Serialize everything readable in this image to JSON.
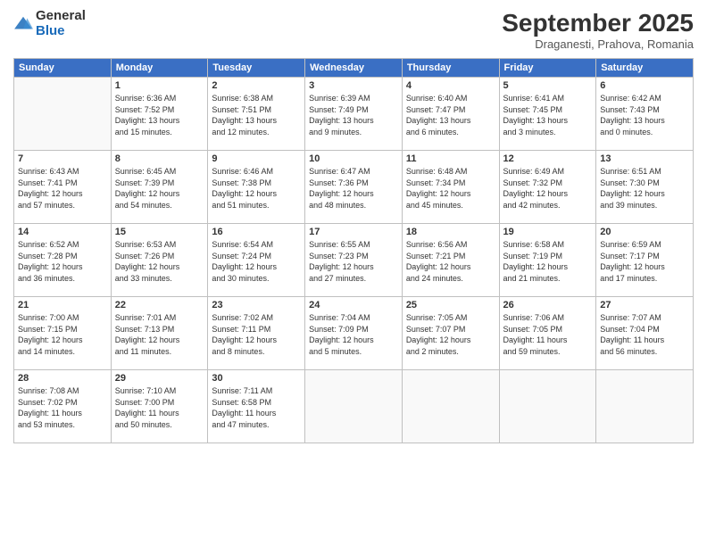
{
  "logo": {
    "general": "General",
    "blue": "Blue"
  },
  "title": "September 2025",
  "location": "Draganesti, Prahova, Romania",
  "weekdays": [
    "Sunday",
    "Monday",
    "Tuesday",
    "Wednesday",
    "Thursday",
    "Friday",
    "Saturday"
  ],
  "days": [
    {
      "date": "",
      "info": ""
    },
    {
      "date": "1",
      "info": "Sunrise: 6:36 AM\nSunset: 7:52 PM\nDaylight: 13 hours\nand 15 minutes."
    },
    {
      "date": "2",
      "info": "Sunrise: 6:38 AM\nSunset: 7:51 PM\nDaylight: 13 hours\nand 12 minutes."
    },
    {
      "date": "3",
      "info": "Sunrise: 6:39 AM\nSunset: 7:49 PM\nDaylight: 13 hours\nand 9 minutes."
    },
    {
      "date": "4",
      "info": "Sunrise: 6:40 AM\nSunset: 7:47 PM\nDaylight: 13 hours\nand 6 minutes."
    },
    {
      "date": "5",
      "info": "Sunrise: 6:41 AM\nSunset: 7:45 PM\nDaylight: 13 hours\nand 3 minutes."
    },
    {
      "date": "6",
      "info": "Sunrise: 6:42 AM\nSunset: 7:43 PM\nDaylight: 13 hours\nand 0 minutes."
    },
    {
      "date": "7",
      "info": "Sunrise: 6:43 AM\nSunset: 7:41 PM\nDaylight: 12 hours\nand 57 minutes."
    },
    {
      "date": "8",
      "info": "Sunrise: 6:45 AM\nSunset: 7:39 PM\nDaylight: 12 hours\nand 54 minutes."
    },
    {
      "date": "9",
      "info": "Sunrise: 6:46 AM\nSunset: 7:38 PM\nDaylight: 12 hours\nand 51 minutes."
    },
    {
      "date": "10",
      "info": "Sunrise: 6:47 AM\nSunset: 7:36 PM\nDaylight: 12 hours\nand 48 minutes."
    },
    {
      "date": "11",
      "info": "Sunrise: 6:48 AM\nSunset: 7:34 PM\nDaylight: 12 hours\nand 45 minutes."
    },
    {
      "date": "12",
      "info": "Sunrise: 6:49 AM\nSunset: 7:32 PM\nDaylight: 12 hours\nand 42 minutes."
    },
    {
      "date": "13",
      "info": "Sunrise: 6:51 AM\nSunset: 7:30 PM\nDaylight: 12 hours\nand 39 minutes."
    },
    {
      "date": "14",
      "info": "Sunrise: 6:52 AM\nSunset: 7:28 PM\nDaylight: 12 hours\nand 36 minutes."
    },
    {
      "date": "15",
      "info": "Sunrise: 6:53 AM\nSunset: 7:26 PM\nDaylight: 12 hours\nand 33 minutes."
    },
    {
      "date": "16",
      "info": "Sunrise: 6:54 AM\nSunset: 7:24 PM\nDaylight: 12 hours\nand 30 minutes."
    },
    {
      "date": "17",
      "info": "Sunrise: 6:55 AM\nSunset: 7:23 PM\nDaylight: 12 hours\nand 27 minutes."
    },
    {
      "date": "18",
      "info": "Sunrise: 6:56 AM\nSunset: 7:21 PM\nDaylight: 12 hours\nand 24 minutes."
    },
    {
      "date": "19",
      "info": "Sunrise: 6:58 AM\nSunset: 7:19 PM\nDaylight: 12 hours\nand 21 minutes."
    },
    {
      "date": "20",
      "info": "Sunrise: 6:59 AM\nSunset: 7:17 PM\nDaylight: 12 hours\nand 17 minutes."
    },
    {
      "date": "21",
      "info": "Sunrise: 7:00 AM\nSunset: 7:15 PM\nDaylight: 12 hours\nand 14 minutes."
    },
    {
      "date": "22",
      "info": "Sunrise: 7:01 AM\nSunset: 7:13 PM\nDaylight: 12 hours\nand 11 minutes."
    },
    {
      "date": "23",
      "info": "Sunrise: 7:02 AM\nSunset: 7:11 PM\nDaylight: 12 hours\nand 8 minutes."
    },
    {
      "date": "24",
      "info": "Sunrise: 7:04 AM\nSunset: 7:09 PM\nDaylight: 12 hours\nand 5 minutes."
    },
    {
      "date": "25",
      "info": "Sunrise: 7:05 AM\nSunset: 7:07 PM\nDaylight: 12 hours\nand 2 minutes."
    },
    {
      "date": "26",
      "info": "Sunrise: 7:06 AM\nSunset: 7:05 PM\nDaylight: 11 hours\nand 59 minutes."
    },
    {
      "date": "27",
      "info": "Sunrise: 7:07 AM\nSunset: 7:04 PM\nDaylight: 11 hours\nand 56 minutes."
    },
    {
      "date": "28",
      "info": "Sunrise: 7:08 AM\nSunset: 7:02 PM\nDaylight: 11 hours\nand 53 minutes."
    },
    {
      "date": "29",
      "info": "Sunrise: 7:10 AM\nSunset: 7:00 PM\nDaylight: 11 hours\nand 50 minutes."
    },
    {
      "date": "30",
      "info": "Sunrise: 7:11 AM\nSunset: 6:58 PM\nDaylight: 11 hours\nand 47 minutes."
    },
    {
      "date": "",
      "info": ""
    },
    {
      "date": "",
      "info": ""
    },
    {
      "date": "",
      "info": ""
    },
    {
      "date": "",
      "info": ""
    }
  ]
}
